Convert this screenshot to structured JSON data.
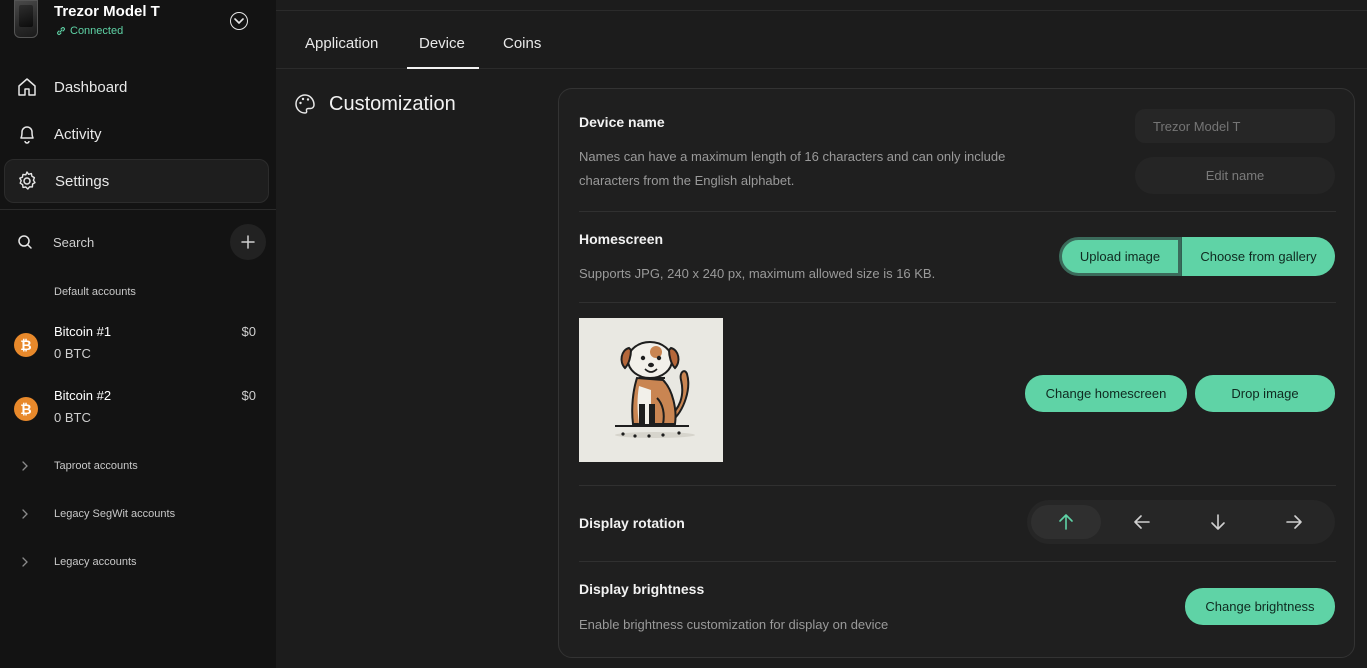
{
  "device": {
    "name": "Trezor Model T",
    "status": "Connected"
  },
  "nav": {
    "items": [
      {
        "label": "Dashboard",
        "icon": "home-icon"
      },
      {
        "label": "Activity",
        "icon": "bell-icon"
      },
      {
        "label": "Settings",
        "icon": "gear-icon",
        "active": true
      }
    ]
  },
  "accounts": {
    "search_label": "Search",
    "default_group": "Default accounts",
    "list": [
      {
        "name": "Bitcoin #1",
        "balance": "0 BTC",
        "fiat": "$0",
        "icon": "bitcoin-icon"
      },
      {
        "name": "Bitcoin #2",
        "balance": "0 BTC",
        "fiat": "$0",
        "icon": "bitcoin-icon"
      }
    ],
    "collapsed_groups": [
      "Taproot accounts",
      "Legacy SegWit accounts",
      "Legacy accounts"
    ]
  },
  "tabs": [
    {
      "label": "Application"
    },
    {
      "label": "Device",
      "active": true
    },
    {
      "label": "Coins"
    }
  ],
  "section": {
    "title": "Customization",
    "icon": "palette-icon"
  },
  "device_name": {
    "title": "Device name",
    "description": "Names can have a maximum length of 16 characters and can only include characters from the English alphabet.",
    "input_placeholder": "Trezor Model T",
    "edit_button": "Edit name"
  },
  "homescreen": {
    "title": "Homescreen",
    "description": "Supports JPG, 240 x 240 px, maximum allowed size is 16 KB.",
    "upload_button": "Upload image",
    "gallery_button": "Choose from gallery",
    "change_button": "Change homescreen",
    "drop_button": "Drop image",
    "preview_icon": "dog-illustration"
  },
  "display_rotation": {
    "title": "Display rotation",
    "options": [
      "arrow-up-icon",
      "arrow-left-icon",
      "arrow-down-icon",
      "arrow-right-icon"
    ],
    "selected": 0
  },
  "display_brightness": {
    "title": "Display brightness",
    "description": "Enable brightness customization for display on device",
    "button": "Change brightness"
  },
  "colors": {
    "accent": "#5fd3a6",
    "background": "#1c1c1c",
    "sidebar": "#131313",
    "bitcoin": "#e8892b"
  }
}
